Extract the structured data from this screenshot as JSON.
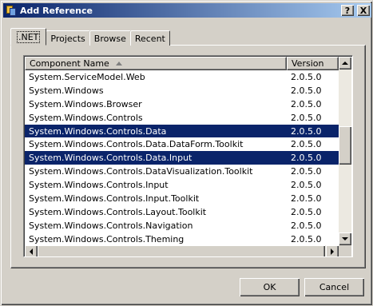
{
  "window": {
    "title": "Add Reference"
  },
  "titlebar": {
    "help_label": "?",
    "close_label": "X"
  },
  "tabs": [
    {
      "label": ".NET",
      "active": true
    },
    {
      "label": "Projects",
      "active": false
    },
    {
      "label": "Browse",
      "active": false
    },
    {
      "label": "Recent",
      "active": false
    }
  ],
  "list": {
    "columns": {
      "name": "Component Name",
      "version": "Version"
    },
    "sort": "ascending",
    "rows": [
      {
        "name": "System.ServiceModel.Web",
        "version": "2.0.5.0",
        "selected": false
      },
      {
        "name": "System.Windows",
        "version": "2.0.5.0",
        "selected": false
      },
      {
        "name": "System.Windows.Browser",
        "version": "2.0.5.0",
        "selected": false
      },
      {
        "name": "System.Windows.Controls",
        "version": "2.0.5.0",
        "selected": false
      },
      {
        "name": "System.Windows.Controls.Data",
        "version": "2.0.5.0",
        "selected": true
      },
      {
        "name": "System.Windows.Controls.Data.DataForm.Toolkit",
        "version": "2.0.5.0",
        "selected": false
      },
      {
        "name": "System.Windows.Controls.Data.Input",
        "version": "2.0.5.0",
        "selected": true
      },
      {
        "name": "System.Windows.Controls.DataVisualization.Toolkit",
        "version": "2.0.5.0",
        "selected": false
      },
      {
        "name": "System.Windows.Controls.Input",
        "version": "2.0.5.0",
        "selected": false
      },
      {
        "name": "System.Windows.Controls.Input.Toolkit",
        "version": "2.0.5.0",
        "selected": false
      },
      {
        "name": "System.Windows.Controls.Layout.Toolkit",
        "version": "2.0.5.0",
        "selected": false
      },
      {
        "name": "System.Windows.Controls.Navigation",
        "version": "2.0.5.0",
        "selected": false
      },
      {
        "name": "System.Windows.Controls.Theming",
        "version": "2.0.5.0",
        "selected": false
      }
    ]
  },
  "buttons": {
    "ok": "OK",
    "cancel": "Cancel"
  },
  "colors": {
    "selection": "#0a246a",
    "face": "#d4d0c8",
    "title_start": "#0a246a",
    "title_end": "#a6caf0"
  }
}
